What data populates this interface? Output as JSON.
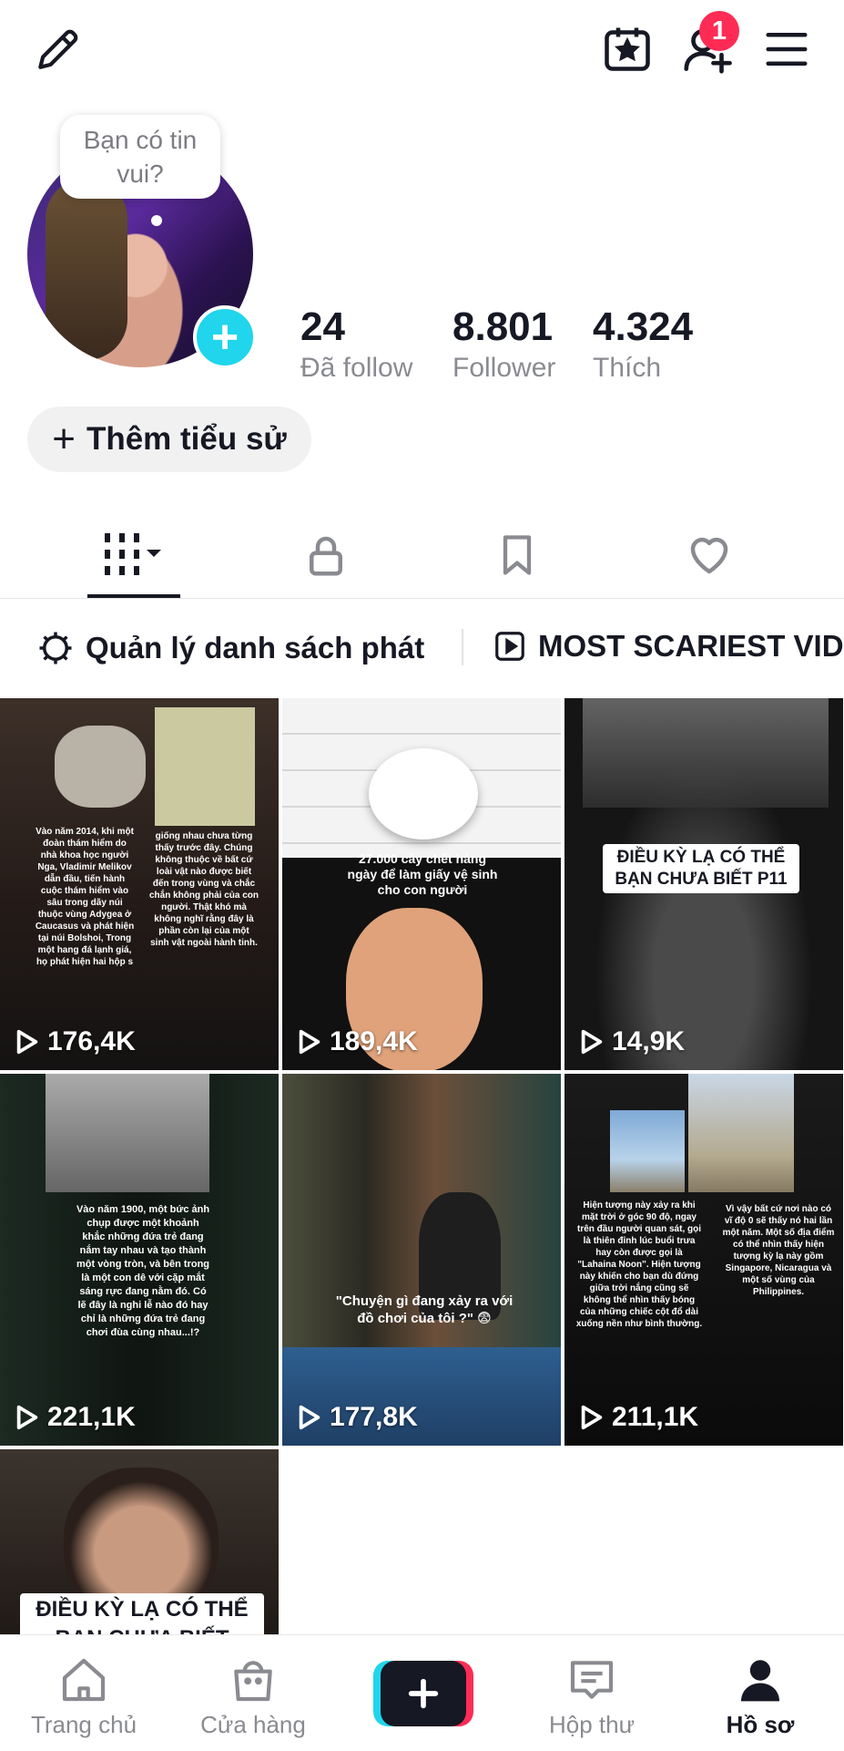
{
  "header": {
    "edit_icon": "pencil-icon",
    "calendar_icon": "calendar-star-icon",
    "add_friend_icon": "add-user-icon",
    "add_friend_badge": "1",
    "menu_icon": "hamburger-icon"
  },
  "profile": {
    "bubble_text": "Bạn có tin vui?",
    "stats": [
      {
        "value": "24",
        "label": "Đã follow"
      },
      {
        "value": "8.801",
        "label": "Follower"
      },
      {
        "value": "4.324",
        "label": "Thích"
      }
    ],
    "bio_button": "Thêm tiểu sử"
  },
  "tabs": {
    "items": [
      {
        "icon": "grid-icon",
        "active": true
      },
      {
        "icon": "lock-icon",
        "active": false
      },
      {
        "icon": "bookmark-icon",
        "active": false
      },
      {
        "icon": "heart-icon",
        "active": false
      }
    ]
  },
  "playlists": {
    "manage_label": "Quản lý danh sách phát",
    "playlist_label": "MOST SCARIEST VID"
  },
  "videos": [
    {
      "views": "176,4K",
      "caption_left": "Vào năm 2014, khi một đoàn thám hiểm do nhà khoa học người Nga, Vladimir Melikov dẫn đầu, tiến hành cuộc thám hiểm vào sâu trong dãy núi thuộc vùng Adygea ở Caucasus và phát hiện tại núi Bolshoi, Trong một hang đá lạnh giá, họ phát hiện hai hộp s",
      "caption_right": "giống nhau chưa từng thấy trước đây. Chúng không thuộc về bất cứ loài vật nào được biết đến trong vùng và chắc chắn không phải của con người. Thật khó mà không nghĩ rằng đây là phần còn lại của một sinh vật ngoài hành tinh."
    },
    {
      "views": "189,4K",
      "caption": "27.000 cây chết hàng ngày để làm giấy vệ sinh cho con người"
    },
    {
      "views": "14,9K",
      "label": "ĐIỀU KỲ LẠ CÓ THỂ BẠN CHƯA BIẾT P11"
    },
    {
      "views": "221,1K",
      "caption": "Vào năm 1900, một bức ảnh chụp được một khoảnh khắc những đứa trẻ đang nắm tay nhau và tạo thành một vòng tròn, và bên trong là một con dê với cặp mắt sáng rực đang nằm đó. Có lẽ đây là nghi lễ nào đó hay chỉ là những đứa trẻ đang chơi đùa cùng nhau...!?"
    },
    {
      "views": "177,8K",
      "caption": "\"Chuyện gì đang xảy ra với đồ chơi của tôi ?\" 😨"
    },
    {
      "views": "211,1K",
      "caption_left": "Hiện tượng này xảy ra khi mặt trời ở góc 90 độ, ngay trên đầu người quan sát, gọi là thiên đỉnh lúc buổi trưa hay còn được gọi là \"Lahaina Noon\". Hiện tượng này khiến cho bạn dù đứng giữa trời nắng cũng sẽ không thể nhìn thấy bóng của những chiếc cột đổ dài xuống nền như bình thường.",
      "caption_right": "Vì vậy bất cứ nơi nào có vĩ độ 0 sẽ thấy nó hai lần một năm. Một số địa điểm có thể nhìn thấy hiện tượng kỳ lạ này gồm Singapore, Nicaragua và một số vùng của Philippines."
    },
    {
      "label": "ĐIỀU KỲ LẠ CÓ THỂ BẠN CHƯA BIẾT"
    }
  ],
  "bottom_nav": {
    "items": [
      {
        "label": "Trang chủ",
        "icon": "home-icon"
      },
      {
        "label": "Cửa hàng",
        "icon": "shopping-bag-icon"
      },
      {
        "label": "",
        "icon": "plus-icon"
      },
      {
        "label": "Hộp thư",
        "icon": "inbox-icon"
      },
      {
        "label": "Hồ sơ",
        "icon": "profile-icon"
      }
    ]
  },
  "colors": {
    "accent": "#fe2c55",
    "cyan": "#20d5ec",
    "text": "#161823",
    "muted": "#8a8b91"
  }
}
